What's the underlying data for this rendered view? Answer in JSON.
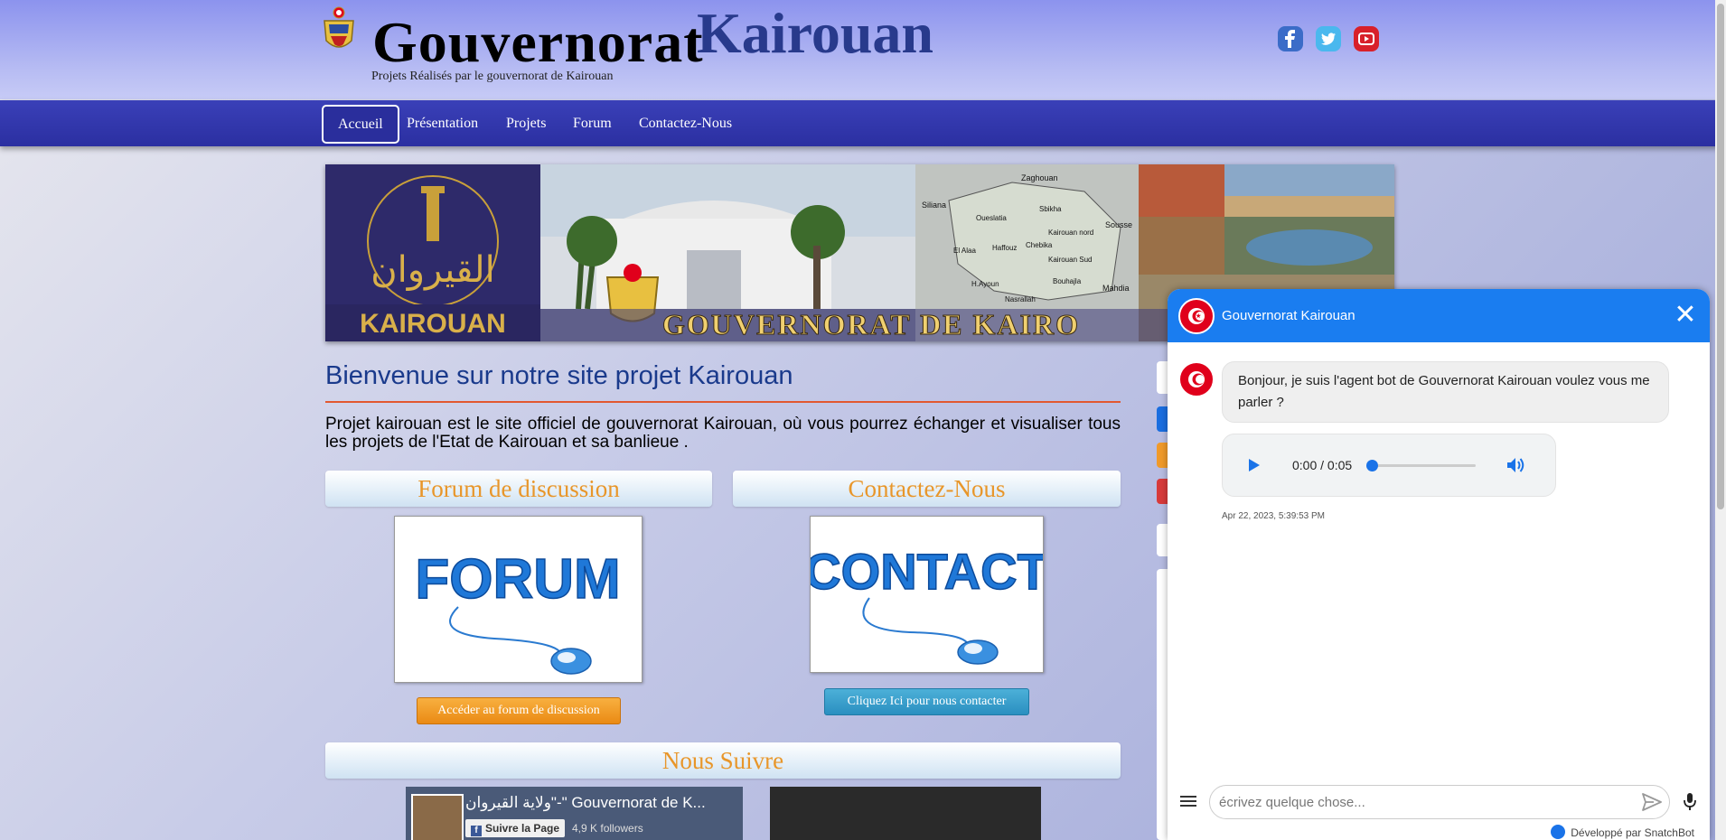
{
  "header": {
    "title_part1": "Gouvernorat",
    "title_part2": "Kairouan",
    "subtitle": "Projets Réalisés par le gouvernorat de Kairouan",
    "social": [
      "facebook-icon",
      "twitter-icon",
      "youtube-icon"
    ]
  },
  "nav": {
    "items": [
      {
        "label": "Accueil",
        "active": true
      },
      {
        "label": "Présentation"
      },
      {
        "label": "Projets"
      },
      {
        "label": "Forum"
      },
      {
        "label": "Contactez-Nous"
      }
    ]
  },
  "banner": {
    "kairouan_label": "KAIROUAN",
    "arabic_logo": "القيروان",
    "caption": "GOUVERNORAT DE KAIRO",
    "map_labels": [
      "Zaghouan",
      "Siliana",
      "Sousse",
      "Oueslatia",
      "Sbikha",
      "Kairouan nord",
      "Kairouan Sud",
      "Haffouz",
      "Chebika",
      "H.Ayoun",
      "Bouhajla",
      "Nasrallah",
      "Mahdia",
      "El Alaa"
    ]
  },
  "main": {
    "welcome_title": "Bienvenue sur notre site projet Kairouan",
    "welcome_text": "Projet kairouan est le site officiel de gouvernorat Kairouan, où vous pourrez échanger et visualiser tous les projets de l'Etat de Kairouan et sa banlieue .",
    "forum": {
      "heading": "Forum de discussion",
      "image_text": "FORUM",
      "button": "Accéder au forum de discussion"
    },
    "contact": {
      "heading": "Contactez-Nous",
      "image_text": "CONTACT",
      "button": "Cliquez Ici pour nous contacter"
    },
    "follow": {
      "heading": "Nous Suivre",
      "fb_page_name": "ولاية القيروان\"-\" Gouvernorat de K...",
      "fb_follow_label": "Suivre la Page",
      "fb_followers": "4,9 K followers"
    }
  },
  "chat": {
    "header_title": "Gouvernorat Kairouan",
    "bot_message": "Bonjour, je suis l'agent bot de Gouvernorat Kairouan voulez vous me parler ?",
    "audio_time": "0:00 / 0:05",
    "audio_progress": 0,
    "timestamp": "Apr 22, 2023, 5:39:53 PM",
    "input_placeholder": "écrivez quelque chose...",
    "powered_by": "Développé par SnatchBot",
    "brand_color": "#1a7df0"
  }
}
